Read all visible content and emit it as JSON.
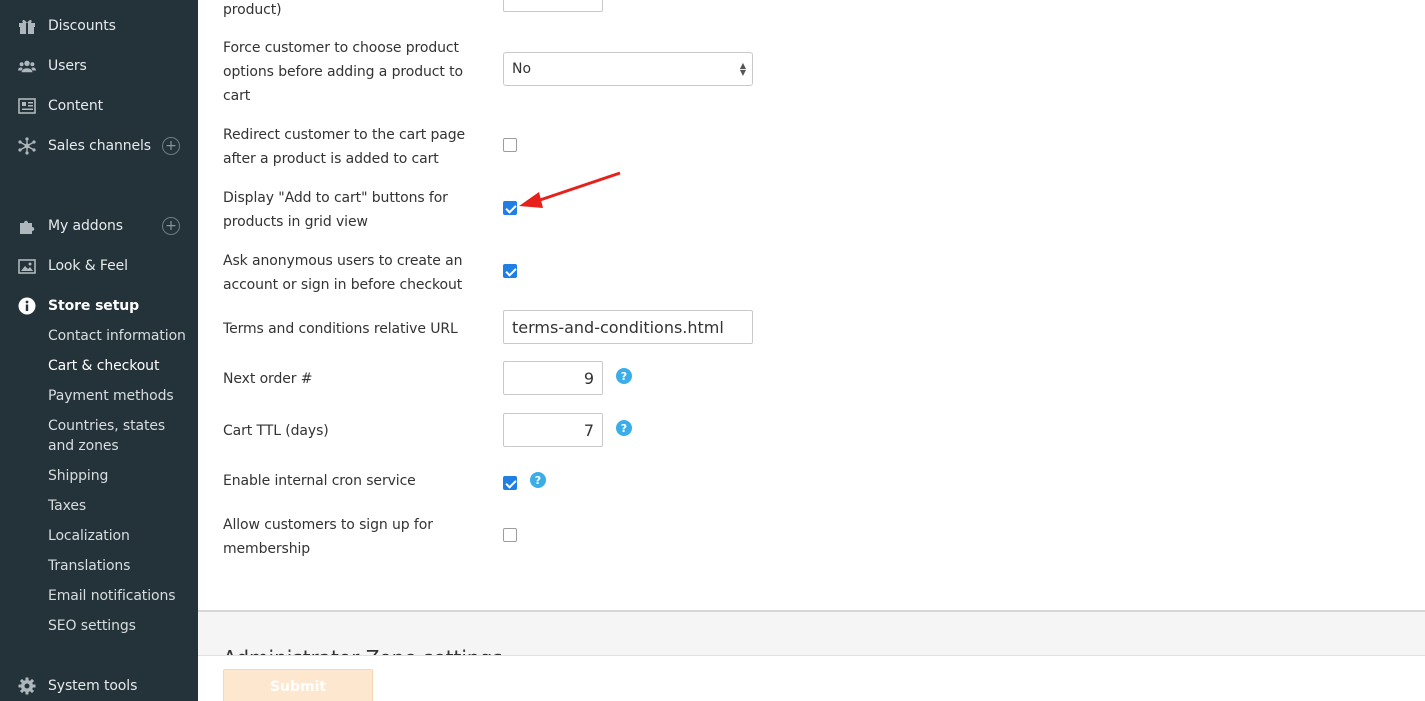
{
  "sidebar": {
    "items": [
      {
        "label": "Discounts",
        "icon": "gift-icon"
      },
      {
        "label": "Users",
        "icon": "users-icon"
      },
      {
        "label": "Content",
        "icon": "content-icon"
      },
      {
        "label": "Sales channels",
        "icon": "network-icon",
        "has_add": true
      },
      {
        "label": "My addons",
        "icon": "puzzle-icon",
        "has_add": true
      },
      {
        "label": "Look & Feel",
        "icon": "image-icon"
      },
      {
        "label": "Store setup",
        "icon": "info-icon",
        "active": true
      },
      {
        "label": "System tools",
        "icon": "gear-icon"
      }
    ],
    "store_setup_sub": [
      "Contact information",
      "Cart & checkout",
      "Payment methods",
      "Countries, states",
      "and zones",
      "Shipping",
      "Taxes",
      "Localization",
      "Translations",
      "Email notifications",
      "SEO settings"
    ],
    "add_symbol": "+"
  },
  "settings": {
    "top_partial_label": "product)",
    "force_options": {
      "label_lines": [
        "Force customer to choose product",
        "options before adding a product to",
        "cart"
      ],
      "value": "No"
    },
    "redirect_cart": {
      "label_lines": [
        "Redirect customer to the cart page",
        "after a product is added to cart"
      ],
      "checked": false
    },
    "add_to_cart_grid": {
      "label_lines": [
        "Display \"Add to cart\" buttons for",
        "products in grid view"
      ],
      "checked": true
    },
    "anonymous_signin": {
      "label_lines": [
        "Ask anonymous users to create an",
        "account or sign in before checkout"
      ],
      "checked": true
    },
    "terms_url": {
      "label": "Terms and conditions relative URL",
      "value": "terms-and-conditions.html"
    },
    "next_order": {
      "label": "Next order #",
      "value": "9"
    },
    "cart_ttl": {
      "label": "Cart TTL (days)",
      "value": "7"
    },
    "internal_cron": {
      "label": "Enable internal cron service",
      "checked": true
    },
    "membership_signup": {
      "label_lines": [
        "Allow customers to sign up for",
        "membership"
      ],
      "checked": false
    }
  },
  "help_symbol": "?",
  "next_section": {
    "title": "Administrator Zone settings"
  },
  "submit_label": "Submit",
  "colors": {
    "sidebar_bg": "#243239",
    "accent": "#1f7fe5",
    "help": "#3aaee8",
    "annotation": "#e8201b"
  }
}
